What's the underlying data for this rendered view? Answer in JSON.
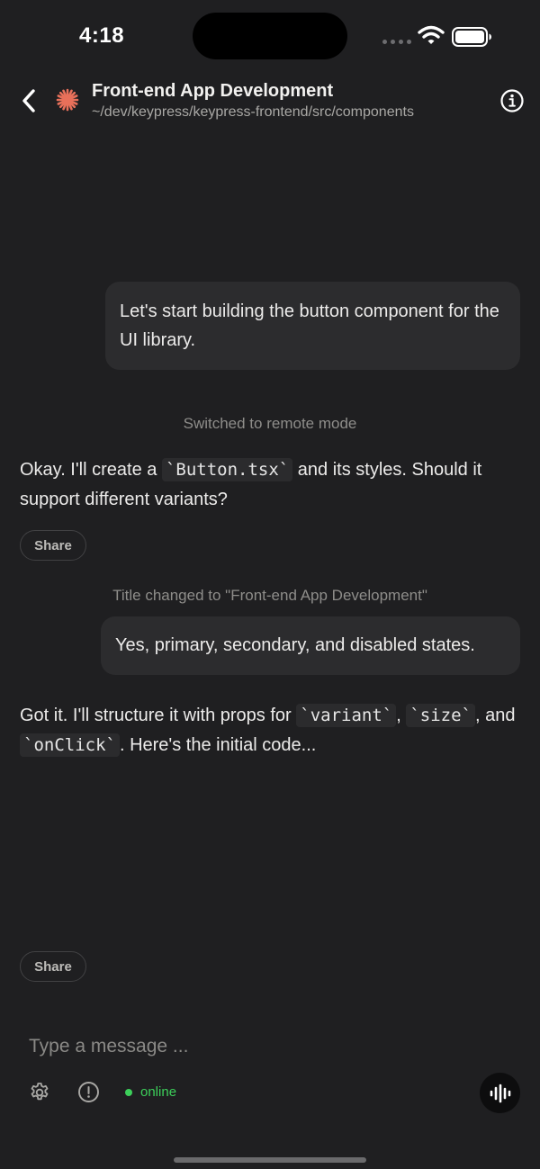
{
  "status_bar": {
    "time": "4:18"
  },
  "header": {
    "title": "Front-end App Development",
    "path": "~/dev/keypress/keypress-frontend/src/components"
  },
  "messages": {
    "user_1": "Let's start building the button component for the UI library.",
    "system_1": "Switched to remote mode",
    "assistant_1": {
      "part1": "Okay. I'll create a ",
      "code1": "`Button.tsx`",
      "part2": " and its styles. Should it support different variants?"
    },
    "share_label_1": "Share",
    "system_2": "Title changed to \"Front-end App Development\"",
    "user_2": "Yes, primary, secondary, and disabled states.",
    "assistant_2": {
      "part1": "Got it. I'll structure it with props for ",
      "code1": "`variant`",
      "sep1": ", ",
      "code2": "`size`",
      "part2": ", and ",
      "code3": "`onClick`",
      "part3": ". Here's the initial code..."
    },
    "share_label_2": "Share"
  },
  "composer": {
    "placeholder": "Type a message ...",
    "status": "online"
  },
  "colors": {
    "background": "#1f1f21",
    "bubble": "#2c2c2e",
    "accent_logo": "#e8705a",
    "online": "#3ccf5a"
  }
}
